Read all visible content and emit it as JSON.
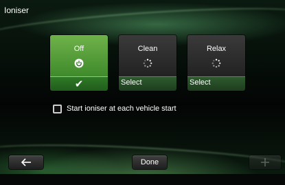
{
  "header": {
    "title": "Ioniser"
  },
  "modes": [
    {
      "label": "Off",
      "icon": "power-icon",
      "footer": "",
      "selected": true
    },
    {
      "label": "Clean",
      "icon": "loading-dots-icon",
      "footer": "Select",
      "selected": false
    },
    {
      "label": "Relax",
      "icon": "loading-dots-icon",
      "footer": "Select",
      "selected": false
    }
  ],
  "option": {
    "label": "Start ioniser at each vehicle start",
    "checked": false
  },
  "footer": {
    "back_icon": "back-arrow-icon",
    "done_label": "Done",
    "add_icon": "plus-icon"
  },
  "colors": {
    "accent": "#3f8a2c",
    "select_bar": "#2e5a2e",
    "text": "#ffffff"
  }
}
